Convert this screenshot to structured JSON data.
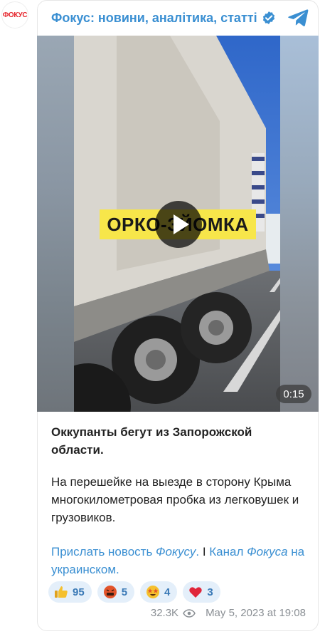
{
  "channel": {
    "avatar_text": "ФОКУС",
    "title": "Фокус: новини, аналітика, статті"
  },
  "video": {
    "overlay_text": "ОРКО-ЗЙОМКА",
    "duration": "0:15"
  },
  "post": {
    "headline": "Оккупанты бегут из Запорожской области.",
    "body": "На перешейке на выезде в сторону Крыма многокилометровая пробка из легковушек и грузовиков.",
    "link1_a": "Прислать новость ",
    "link1_b": "Фокусу",
    "link1_c": ".",
    "separator": " I ",
    "link2_a": "Канал ",
    "link2_b": "Фокуса",
    "link2_c": " на украинском."
  },
  "reactions": [
    {
      "emoji": "thumbs-up",
      "count": "95"
    },
    {
      "emoji": "angry-face",
      "count": "5"
    },
    {
      "emoji": "star-struck",
      "count": "4"
    },
    {
      "emoji": "heart",
      "count": "3"
    }
  ],
  "footer": {
    "views": "32.3K",
    "date": "May 5, 2023 at 19:08"
  },
  "colors": {
    "accent": "#3a8fd2",
    "reaction_bg": "#e4effa",
    "overlay": "#f7e64a"
  }
}
